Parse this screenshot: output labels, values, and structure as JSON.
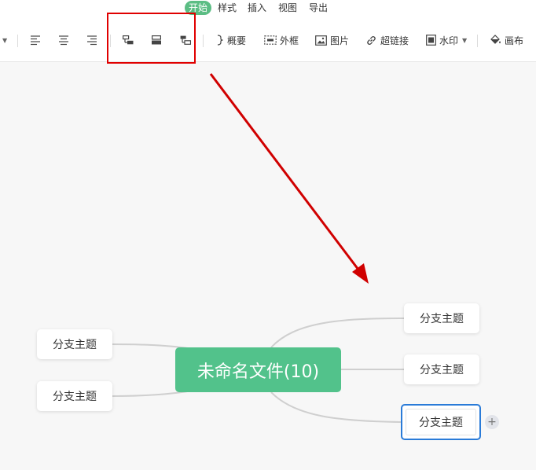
{
  "menu": {
    "items": [
      "开始",
      "样式",
      "插入",
      "视图",
      "导出"
    ],
    "active_index": 0
  },
  "toolbar": {
    "align_left_icon": "align-left-icon",
    "align_center_icon": "align-center-icon",
    "align_right_icon": "align-right-icon",
    "structure_icons": [
      "structure-left-icon",
      "structure-center-icon",
      "structure-right-icon"
    ],
    "summary_label": "概要",
    "frame_label": "外框",
    "image_label": "图片",
    "hyperlink_label": "超链接",
    "watermark_label": "水印",
    "canvas_label": "画布"
  },
  "mindmap": {
    "root": "未命名文件(10)",
    "right_branches": [
      "分支主题",
      "分支主题",
      "分支主题"
    ],
    "left_branches": [
      "分支主题",
      "分支主题"
    ],
    "selected_branch": "right-3"
  },
  "colors": {
    "accent": "#5bbd84",
    "root_fill": "#52c28b",
    "annotation_red": "#e00000",
    "selection_blue": "#2a7bd8"
  }
}
